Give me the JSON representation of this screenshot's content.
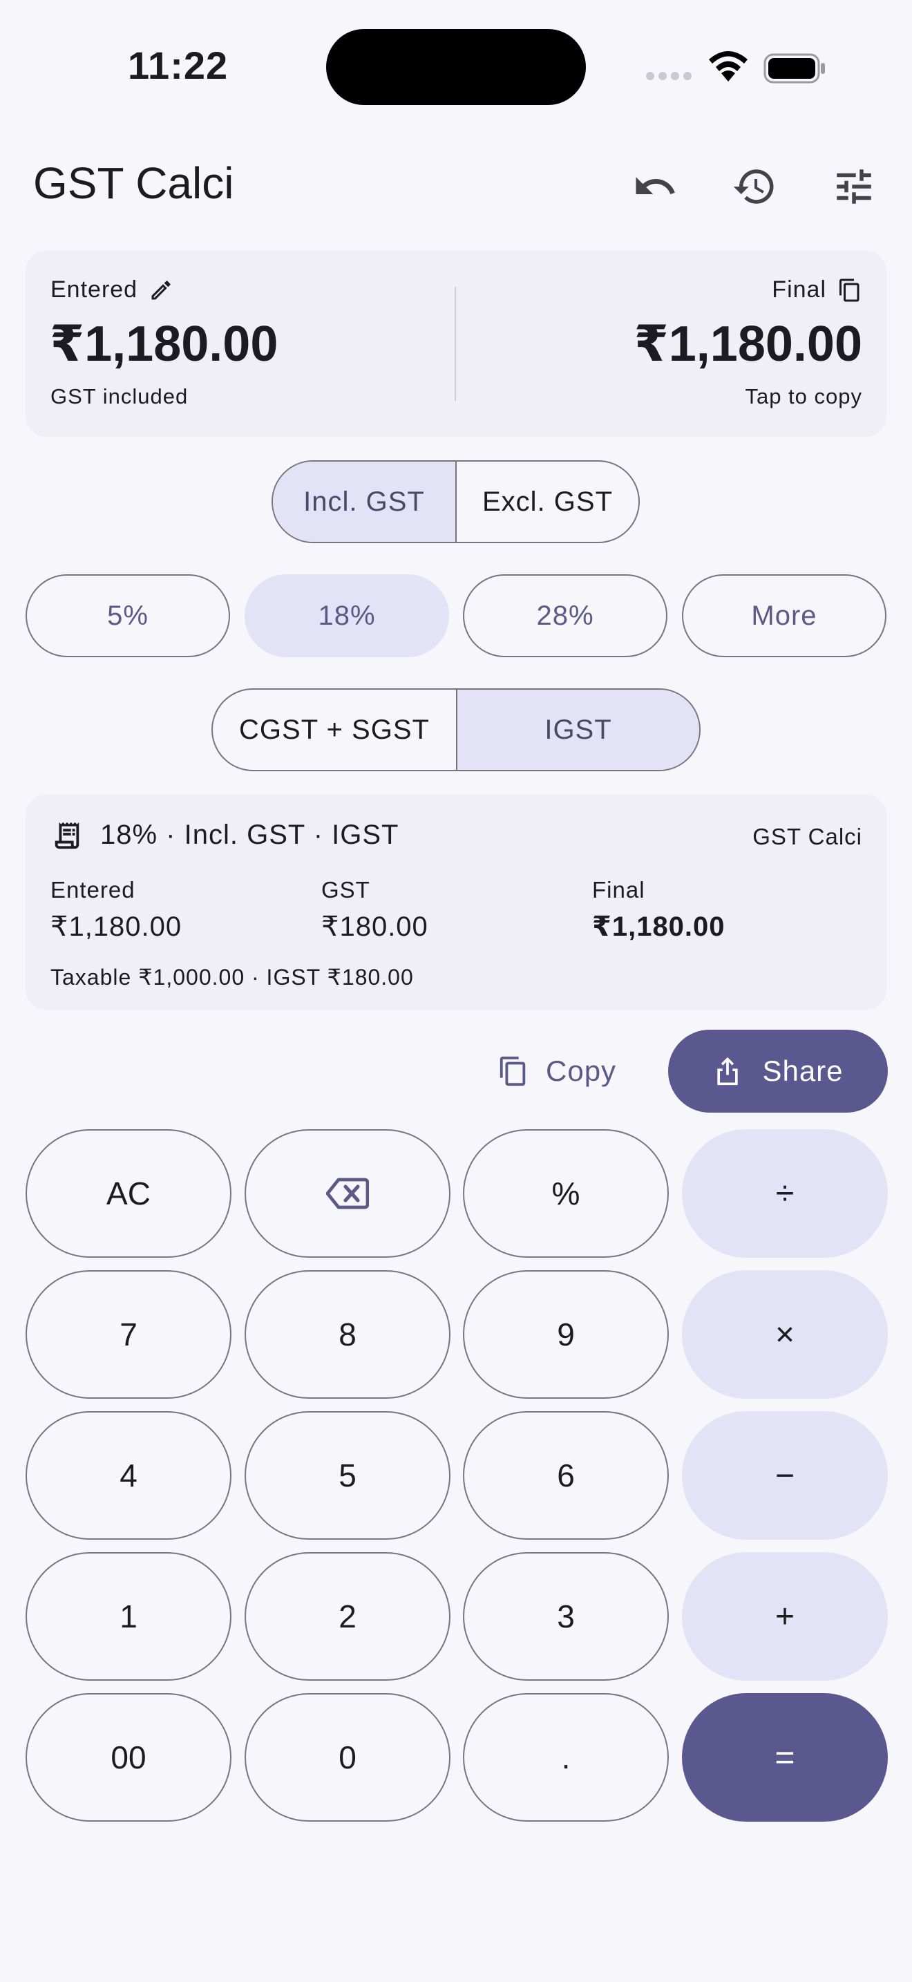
{
  "status_bar": {
    "time": "11:22"
  },
  "app_bar": {
    "title": "GST Calci"
  },
  "summary": {
    "entered_label": "Entered",
    "entered_value": "₹1,180.00",
    "entered_note": "GST included",
    "final_label": "Final",
    "final_value": "₹1,180.00",
    "final_note": "Tap to copy"
  },
  "mode_toggle": {
    "incl": "Incl. GST",
    "excl": "Excl. GST",
    "selected": "Incl. GST"
  },
  "rates": {
    "items": [
      "5%",
      "18%",
      "28%",
      "More"
    ],
    "selected": "18%"
  },
  "tax_type": {
    "cgst_sgst": "CGST + SGST",
    "igst": "IGST",
    "selected": "IGST"
  },
  "details": {
    "heading": "18% · Incl. GST · IGST",
    "brand": "GST Calci",
    "entered_label": "Entered",
    "entered_value": "₹1,180.00",
    "gst_label": "GST",
    "gst_value": "₹180.00",
    "final_label": "Final",
    "final_value": "₹1,180.00",
    "breakdown": "Taxable ₹1,000.00 · IGST ₹180.00"
  },
  "actions": {
    "copy": "Copy",
    "share": "Share"
  },
  "keypad": {
    "row1": [
      "AC",
      "",
      "%",
      "÷"
    ],
    "row2": [
      "7",
      "8",
      "9",
      "×"
    ],
    "row3": [
      "4",
      "5",
      "6",
      "−"
    ],
    "row4": [
      "1",
      "2",
      "3",
      "+"
    ],
    "row5": [
      "00",
      "0",
      ".",
      "="
    ]
  },
  "colors": {
    "accent": "#5b5890",
    "tonal": "#e3e2f6",
    "background": "#f6f6fb",
    "card": "#f1eff6"
  },
  "icons": [
    "pencil-icon",
    "copy-icon",
    "undo-icon",
    "history-icon",
    "tune-icon",
    "receipt-icon",
    "share-icon",
    "backspace-icon"
  ]
}
